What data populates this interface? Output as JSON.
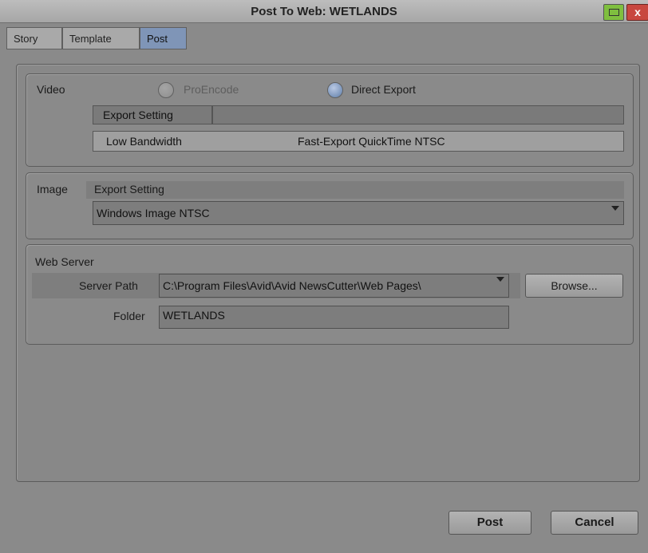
{
  "window": {
    "title": "Post To Web: WETLANDS",
    "close_glyph": "x",
    "minimize_icon": "minimize-icon",
    "close_icon": "close-icon"
  },
  "tabs": [
    {
      "label": "Story",
      "active": false
    },
    {
      "label": "Template",
      "active": false
    },
    {
      "label": "Post",
      "active": true
    }
  ],
  "video": {
    "label": "Video",
    "options": [
      {
        "label": "ProEncode",
        "selected": false,
        "enabled": false
      },
      {
        "label": "Direct Export",
        "selected": true,
        "enabled": true
      }
    ],
    "column_header": "Export Setting",
    "rows": [
      {
        "name": "Low Bandwidth",
        "setting": "Fast-Export QuickTime NTSC"
      }
    ]
  },
  "image": {
    "label": "Image",
    "header": "Export Setting",
    "selected": "Windows Image NTSC"
  },
  "web_server": {
    "label": "Web Server",
    "server_path_label": "Server Path",
    "server_path_value": "C:\\Program Files\\Avid\\Avid NewsCutter\\Web Pages\\",
    "browse_label": "Browse...",
    "folder_label": "Folder",
    "folder_value": "WETLANDS"
  },
  "footer": {
    "post_label": "Post",
    "cancel_label": "Cancel"
  },
  "colors": {
    "active_tab": "#7f95b7",
    "minimize_button": "#7fbf3f",
    "close_button": "#c8473f",
    "radio_selected": "#5f7ea8"
  }
}
